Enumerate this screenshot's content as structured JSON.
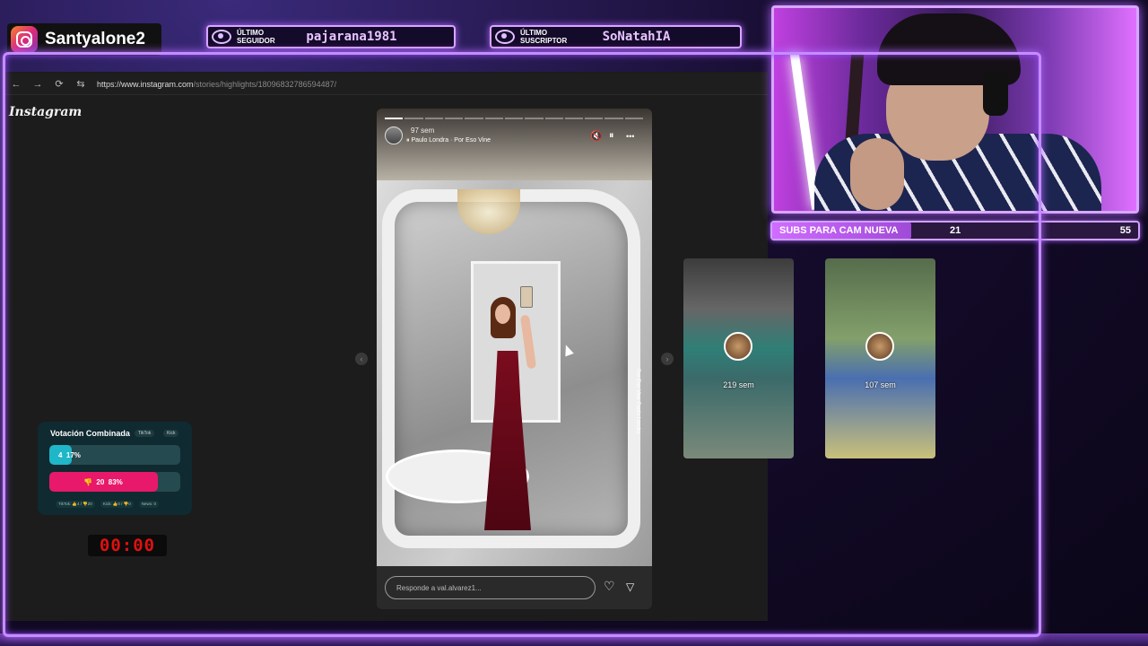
{
  "overlay": {
    "instagram_handle": "Santyalone2",
    "last_follower": {
      "label_line1": "ÚLTIMO",
      "label_line2": "SEGUIDOR",
      "value": "pajarana1981"
    },
    "last_subscriber": {
      "label_line1": "ÚLTIMO",
      "label_line2": "SUSCRIPTOR",
      "value": "SoNatahIA"
    },
    "subs_goal": {
      "label": "SUBS PARA CAM NUEVA",
      "current": "21",
      "goal": "55",
      "progress": 0.38
    },
    "timer": "00:00"
  },
  "browser": {
    "back_icon": "←",
    "forward_icon": "→",
    "reload_icon": "⟳",
    "site_icon": "⇆",
    "url_domain": "https://www.instagram.com",
    "url_path": "/stories/highlights/18096832786594487/"
  },
  "instagram": {
    "wordmark": "Instagram",
    "story": {
      "time_ago": "97 sem",
      "song": "⏸ Paulo Londra · Por Eso Vine",
      "caption_vertical": "Por Eso Vine Paulo Londra",
      "reply_placeholder": "Responde a val.alvarez1...",
      "mute_icon": "🔇",
      "pause_icon": "⏸",
      "more_icon": "•••",
      "like_icon": "♡",
      "send_icon": "▽",
      "prev_icon": "‹",
      "next_icon": "›"
    },
    "thumbnails": [
      {
        "label": "219 sem"
      },
      {
        "label": "107 sem"
      }
    ]
  },
  "vote": {
    "title": "Votación Combinada",
    "chip_tiktok": "TikTok",
    "chip_kick": "Kick",
    "positive": {
      "count": "4",
      "percent": "17%",
      "fraction": 0.17,
      "color": "#1fb6c8"
    },
    "negative": {
      "count": "20",
      "percent": "83%",
      "fraction": 0.83,
      "color": "#e8196a"
    },
    "footer": [
      "TikTok: 👍4 / 👎20",
      "Kick: 👍0 / 👎0",
      "News: 0"
    ]
  }
}
